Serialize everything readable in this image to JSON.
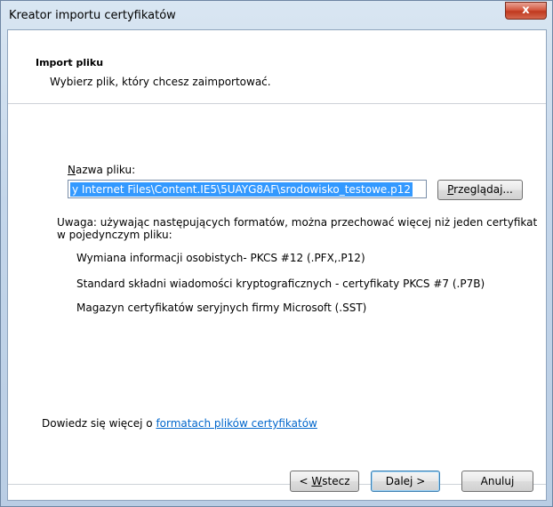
{
  "window": {
    "title": "Kreator importu certyfikatów",
    "close_glyph": "x"
  },
  "header": {
    "title": "Import pliku",
    "subtitle": "Wybierz plik, który chcesz zaimportować."
  },
  "file": {
    "label_mnemonic": "N",
    "label_rest": "azwa pliku:",
    "value": "y Internet Files\\Content.IE5\\5UAYG8AF\\srodowisko_testowe.p12",
    "browse_mnemonic": "P",
    "browse_rest": "rzeglądaj..."
  },
  "note": {
    "text": "Uwaga: używając następujących formatów, można przechować więcej niż jeden certyfikat w pojedynczym pliku:",
    "formats": [
      "Wymiana informacji osobistych- PKCS #12 (.PFX,.P12)",
      "Standard składni wiadomości kryptograficznych - certyfikaty PKCS #7 (.P7B)",
      "Magazyn certyfikatów seryjnych firmy Microsoft (.SST)"
    ]
  },
  "learn_more": {
    "prefix": "Dowiedz się więcej o ",
    "link": "formatach plików certyfikatów"
  },
  "buttons": {
    "back_prefix": "< ",
    "back_mnemonic": "W",
    "back_rest": "stecz",
    "next": "Dalej >",
    "cancel": "Anuluj"
  },
  "colors": {
    "selection": "#3399ff",
    "link": "#0066cc",
    "close": "#c0391f"
  }
}
